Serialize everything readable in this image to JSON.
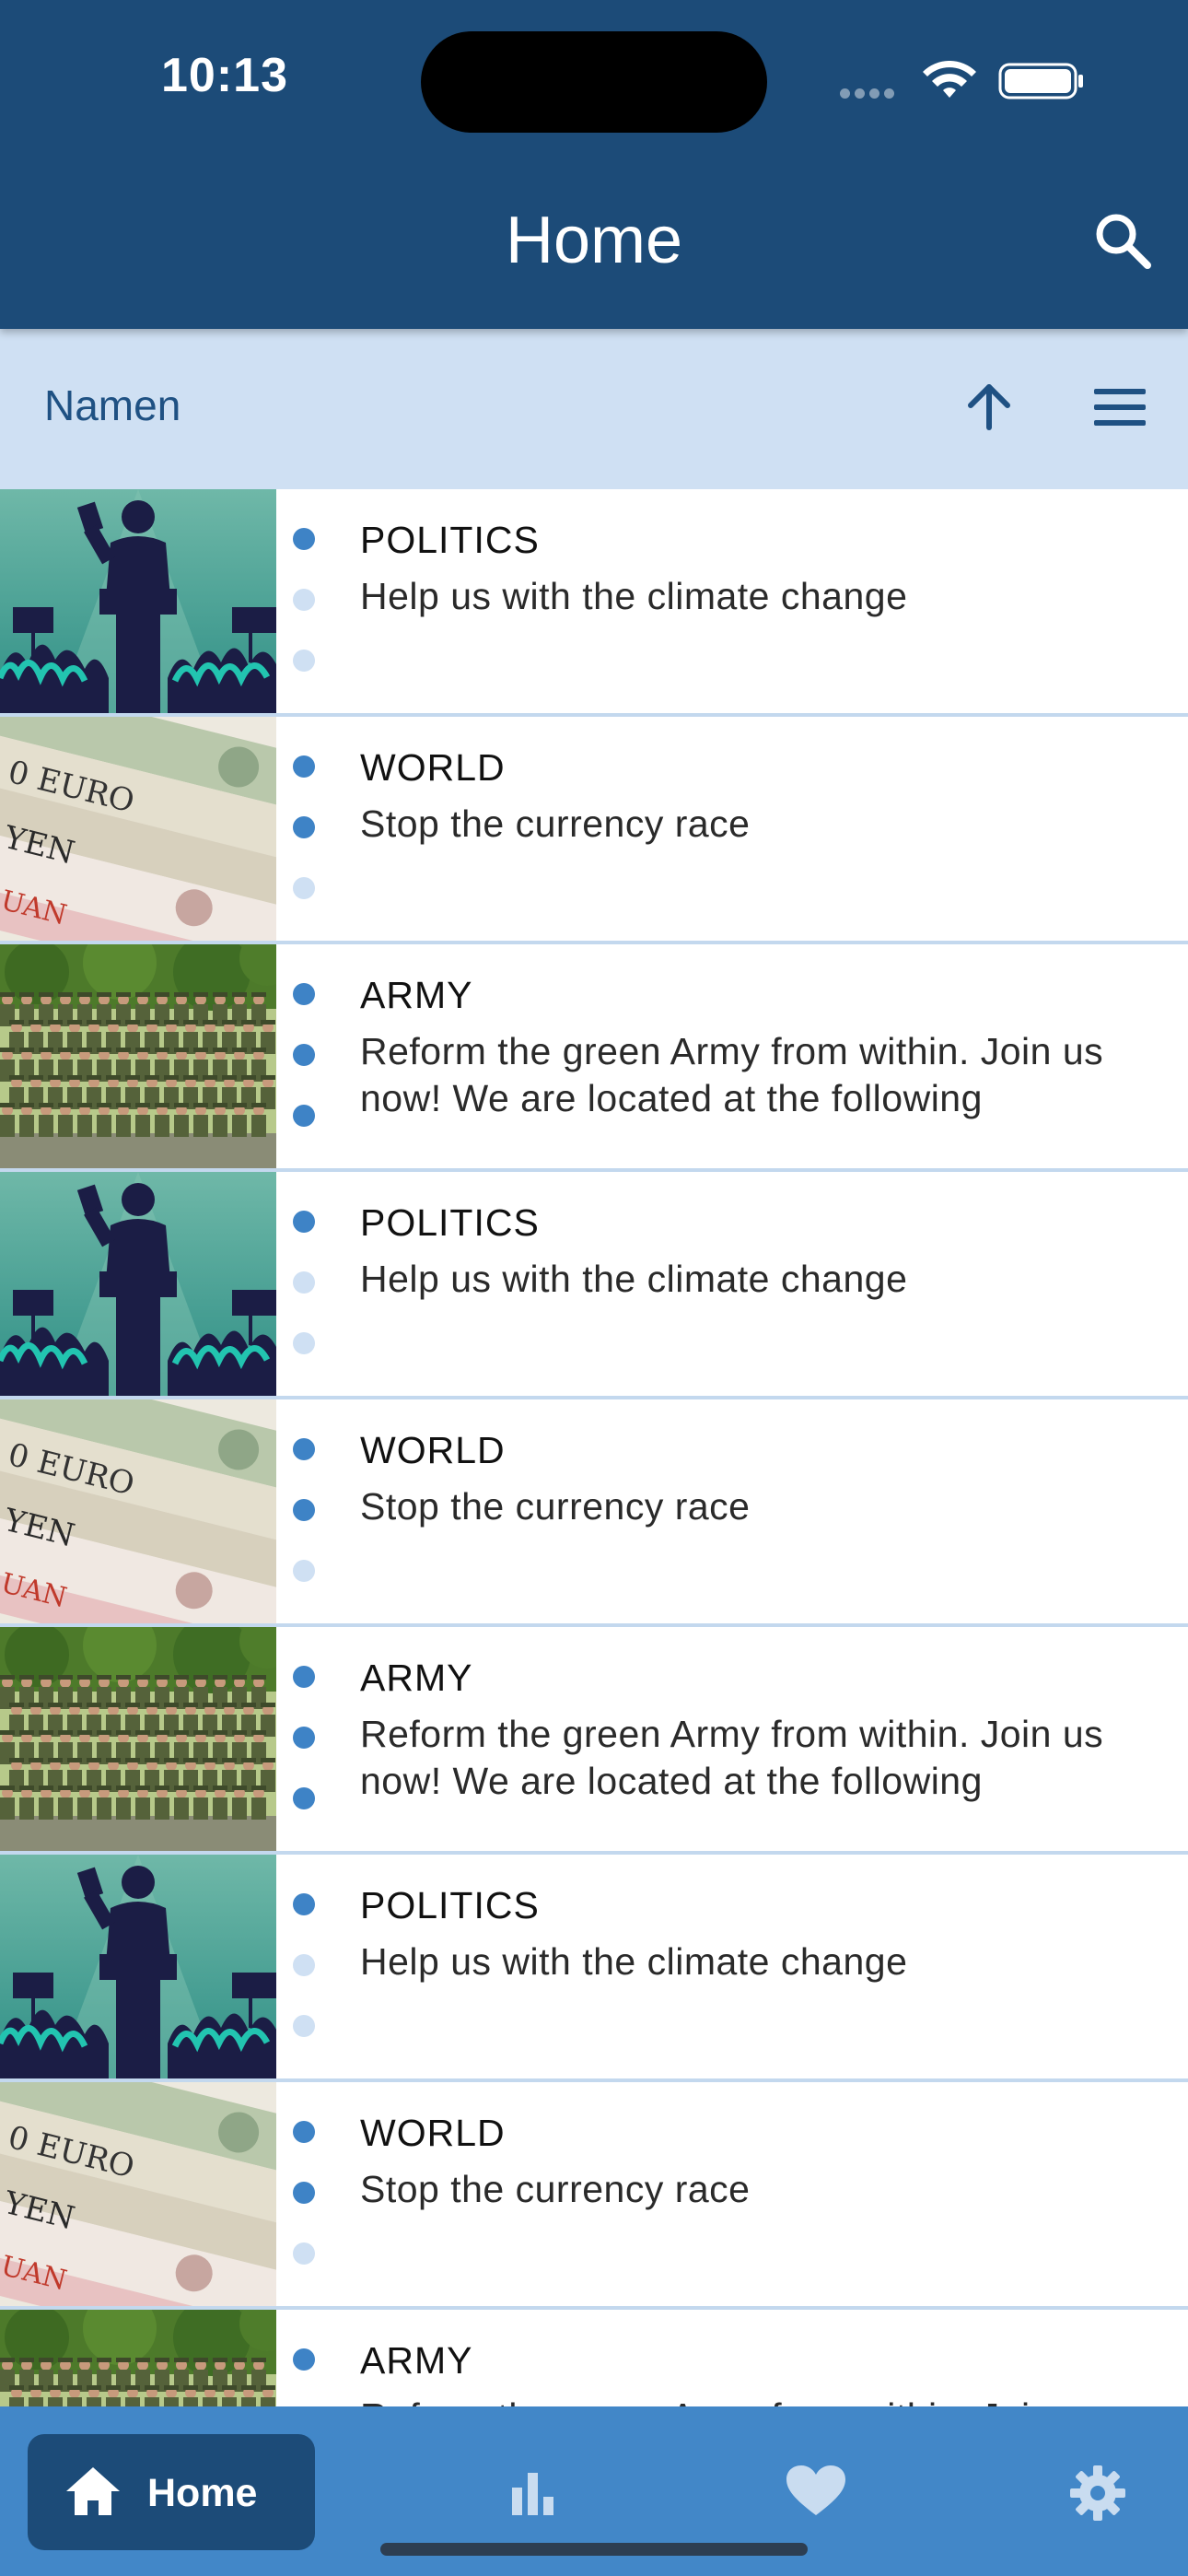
{
  "status_bar": {
    "time": "10:13"
  },
  "app_bar": {
    "title": "Home",
    "search_icon": "search-icon"
  },
  "sort_bar": {
    "label": "Namen",
    "sort_icon": "arrow-up-icon",
    "menu_icon": "hamburger-menu-icon"
  },
  "articles": [
    {
      "category": "POLITICS",
      "text": "Help us with the climate change",
      "image": "politician-speech",
      "indicator": [
        true,
        false,
        false
      ]
    },
    {
      "category": "WORLD",
      "text": "Stop the currency race",
      "image": "banknotes",
      "indicator": [
        true,
        true,
        false
      ]
    },
    {
      "category": "ARMY",
      "text": "Reform the green Army from within. Join us now! We are located at the following",
      "image": "soldiers",
      "indicator": [
        true,
        true,
        true
      ]
    },
    {
      "category": "POLITICS",
      "text": "Help us with the climate change",
      "image": "politician-speech",
      "indicator": [
        true,
        false,
        false
      ]
    },
    {
      "category": "WORLD",
      "text": "Stop the currency race",
      "image": "banknotes",
      "indicator": [
        true,
        true,
        false
      ]
    },
    {
      "category": "ARMY",
      "text": "Reform the green Army from within. Join us now! We are located at the following",
      "image": "soldiers",
      "indicator": [
        true,
        true,
        true
      ]
    },
    {
      "category": "POLITICS",
      "text": "Help us with the climate change",
      "image": "politician-speech",
      "indicator": [
        true,
        false,
        false
      ]
    },
    {
      "category": "WORLD",
      "text": "Stop the currency race",
      "image": "banknotes",
      "indicator": [
        true,
        true,
        false
      ]
    },
    {
      "category": "ARMY",
      "text": "Reform the green Army from within. Join us now! We are located at the following",
      "image": "soldiers",
      "indicator": [
        true,
        true,
        true
      ]
    }
  ],
  "bottom_nav": {
    "items": [
      {
        "label": "Home",
        "icon": "home-icon",
        "active": true
      },
      {
        "label": "",
        "icon": "bar-chart-icon",
        "active": false
      },
      {
        "label": "",
        "icon": "heart-icon",
        "active": false
      },
      {
        "label": "",
        "icon": "gear-icon",
        "active": false
      }
    ]
  },
  "colors": {
    "app_bar": "#1c4b78",
    "sort_bar": "#cfe0f3",
    "bottom_nav": "#4287c8",
    "active_dot": "#3e83c6",
    "inactive_dot": "#cfe0f3"
  }
}
